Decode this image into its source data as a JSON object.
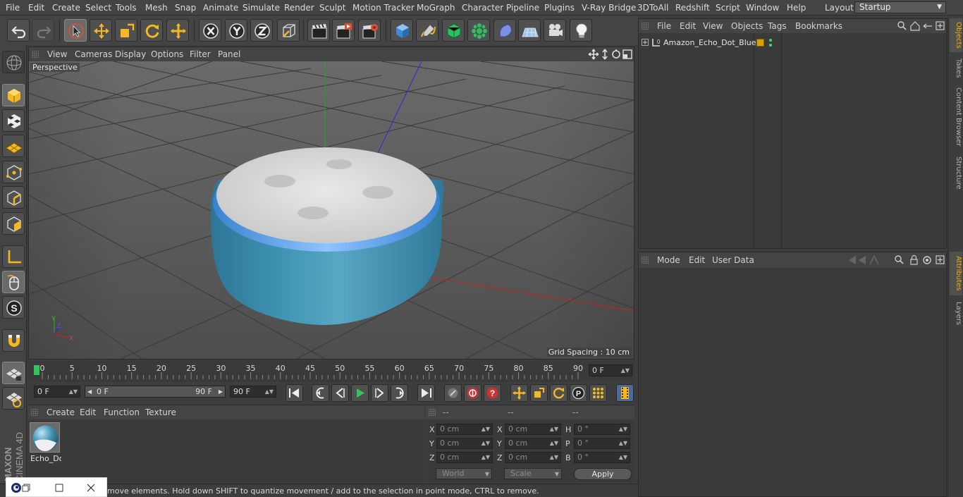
{
  "menu": [
    "File",
    "Edit",
    "Create",
    "Select",
    "Tools",
    "Mesh",
    "Snap",
    "Animate",
    "Simulate",
    "Render",
    "Sculpt",
    "Motion Tracker",
    "MoGraph",
    "Character",
    "Pipeline",
    "Plugins",
    "V-Ray Bridge",
    "3DToAll",
    "Redshift",
    "Script",
    "Window",
    "Help"
  ],
  "layout": {
    "label": "Layout:",
    "value": "Startup"
  },
  "viewport": {
    "menu": [
      "View",
      "Cameras",
      "Display",
      "Options",
      "Filter",
      "Panel"
    ],
    "camera": "Perspective",
    "grid_spacing": "Grid Spacing : 10 cm"
  },
  "timeline": {
    "ticks": [
      "0",
      "5",
      "10",
      "15",
      "20",
      "25",
      "30",
      "35",
      "40",
      "45",
      "50",
      "55",
      "60",
      "65",
      "70",
      "75",
      "80",
      "85",
      "90"
    ],
    "current_frame": "0 F"
  },
  "transport": {
    "start": "0 F",
    "range_start": "0 F",
    "range_end": "90 F",
    "end": "90 F"
  },
  "materials": {
    "menu": [
      "Create",
      "Edit",
      "Function",
      "Texture"
    ],
    "item_name": "Echo_Do"
  },
  "coords": {
    "headers": [
      "--",
      "--",
      "--"
    ],
    "rows": [
      {
        "a": "X",
        "av": "0 cm",
        "b": "X",
        "bv": "0 cm",
        "c": "H",
        "cv": "0 °"
      },
      {
        "a": "Y",
        "av": "0 cm",
        "b": "Y",
        "bv": "0 cm",
        "c": "P",
        "cv": "0 °"
      },
      {
        "a": "Z",
        "av": "0 cm",
        "b": "Z",
        "bv": "0 cm",
        "c": "B",
        "cv": "0 °"
      }
    ],
    "mode": "World",
    "transform": "Scale",
    "apply": "Apply"
  },
  "status": "move elements. Hold down SHIFT to quantize movement / add to the selection in point mode, CTRL to remove.",
  "objects": {
    "menu": [
      "File",
      "Edit",
      "View",
      "Objects",
      "Tags",
      "Bookmarks"
    ],
    "items": [
      {
        "name": "Amazon_Echo_Dot_Blue"
      }
    ]
  },
  "attributes": {
    "menu": [
      "Mode",
      "Edit",
      "User Data"
    ]
  },
  "right_tabs": [
    "Objects",
    "Takes",
    "Content Browser",
    "Structure",
    "Attributes",
    "Layers"
  ],
  "brand": {
    "maxon": "MAXON",
    "product": "CINEMA 4D"
  },
  "colors": {
    "accent": "#f0b000",
    "echo_body": "#3f93b3",
    "echo_ring": "#5aa0e8",
    "x_axis": "#cc2222",
    "y_axis": "#22aa22",
    "z_axis": "#2222cc"
  }
}
